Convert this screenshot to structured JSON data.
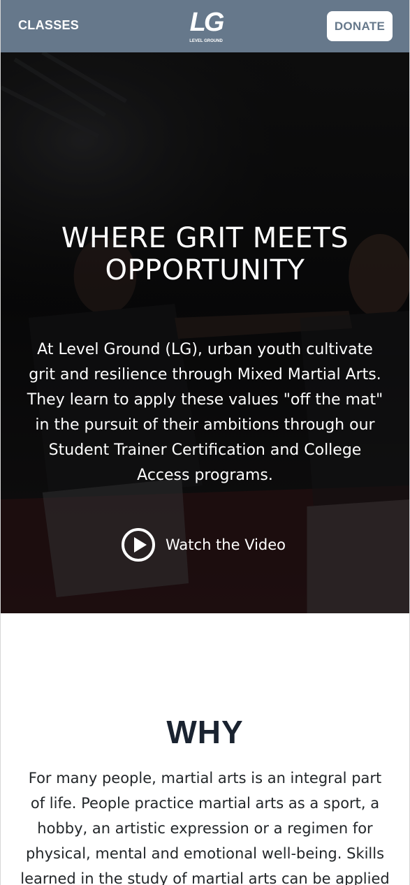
{
  "header": {
    "nav_label": "CLASSES",
    "logo_text": "LG",
    "logo_subtitle": "LEVEL GROUND",
    "donate_label": "DONATE",
    "bar_color": "#66788b"
  },
  "hero": {
    "title_line1": "WHERE GRIT MEETS",
    "title_line2": "OPPORTUNITY",
    "description": "At Level Ground (LG), urban youth cultivate grit and resilience through Mixed Martial Arts. They learn to apply these values \"off the mat\" in the pursuit of their ambitions through our Student Trainer Certification and College Access programs.",
    "video_label": "Watch the Video",
    "video_icon": "play-icon"
  },
  "why": {
    "title": "WHY",
    "text": "For many people, martial arts is an integral part of life. People practice martial arts as a sport, a hobby, an artistic expression or a regimen for physical, mental and emotional well-being. Skills learned in the study of martial arts can be applied in other"
  }
}
